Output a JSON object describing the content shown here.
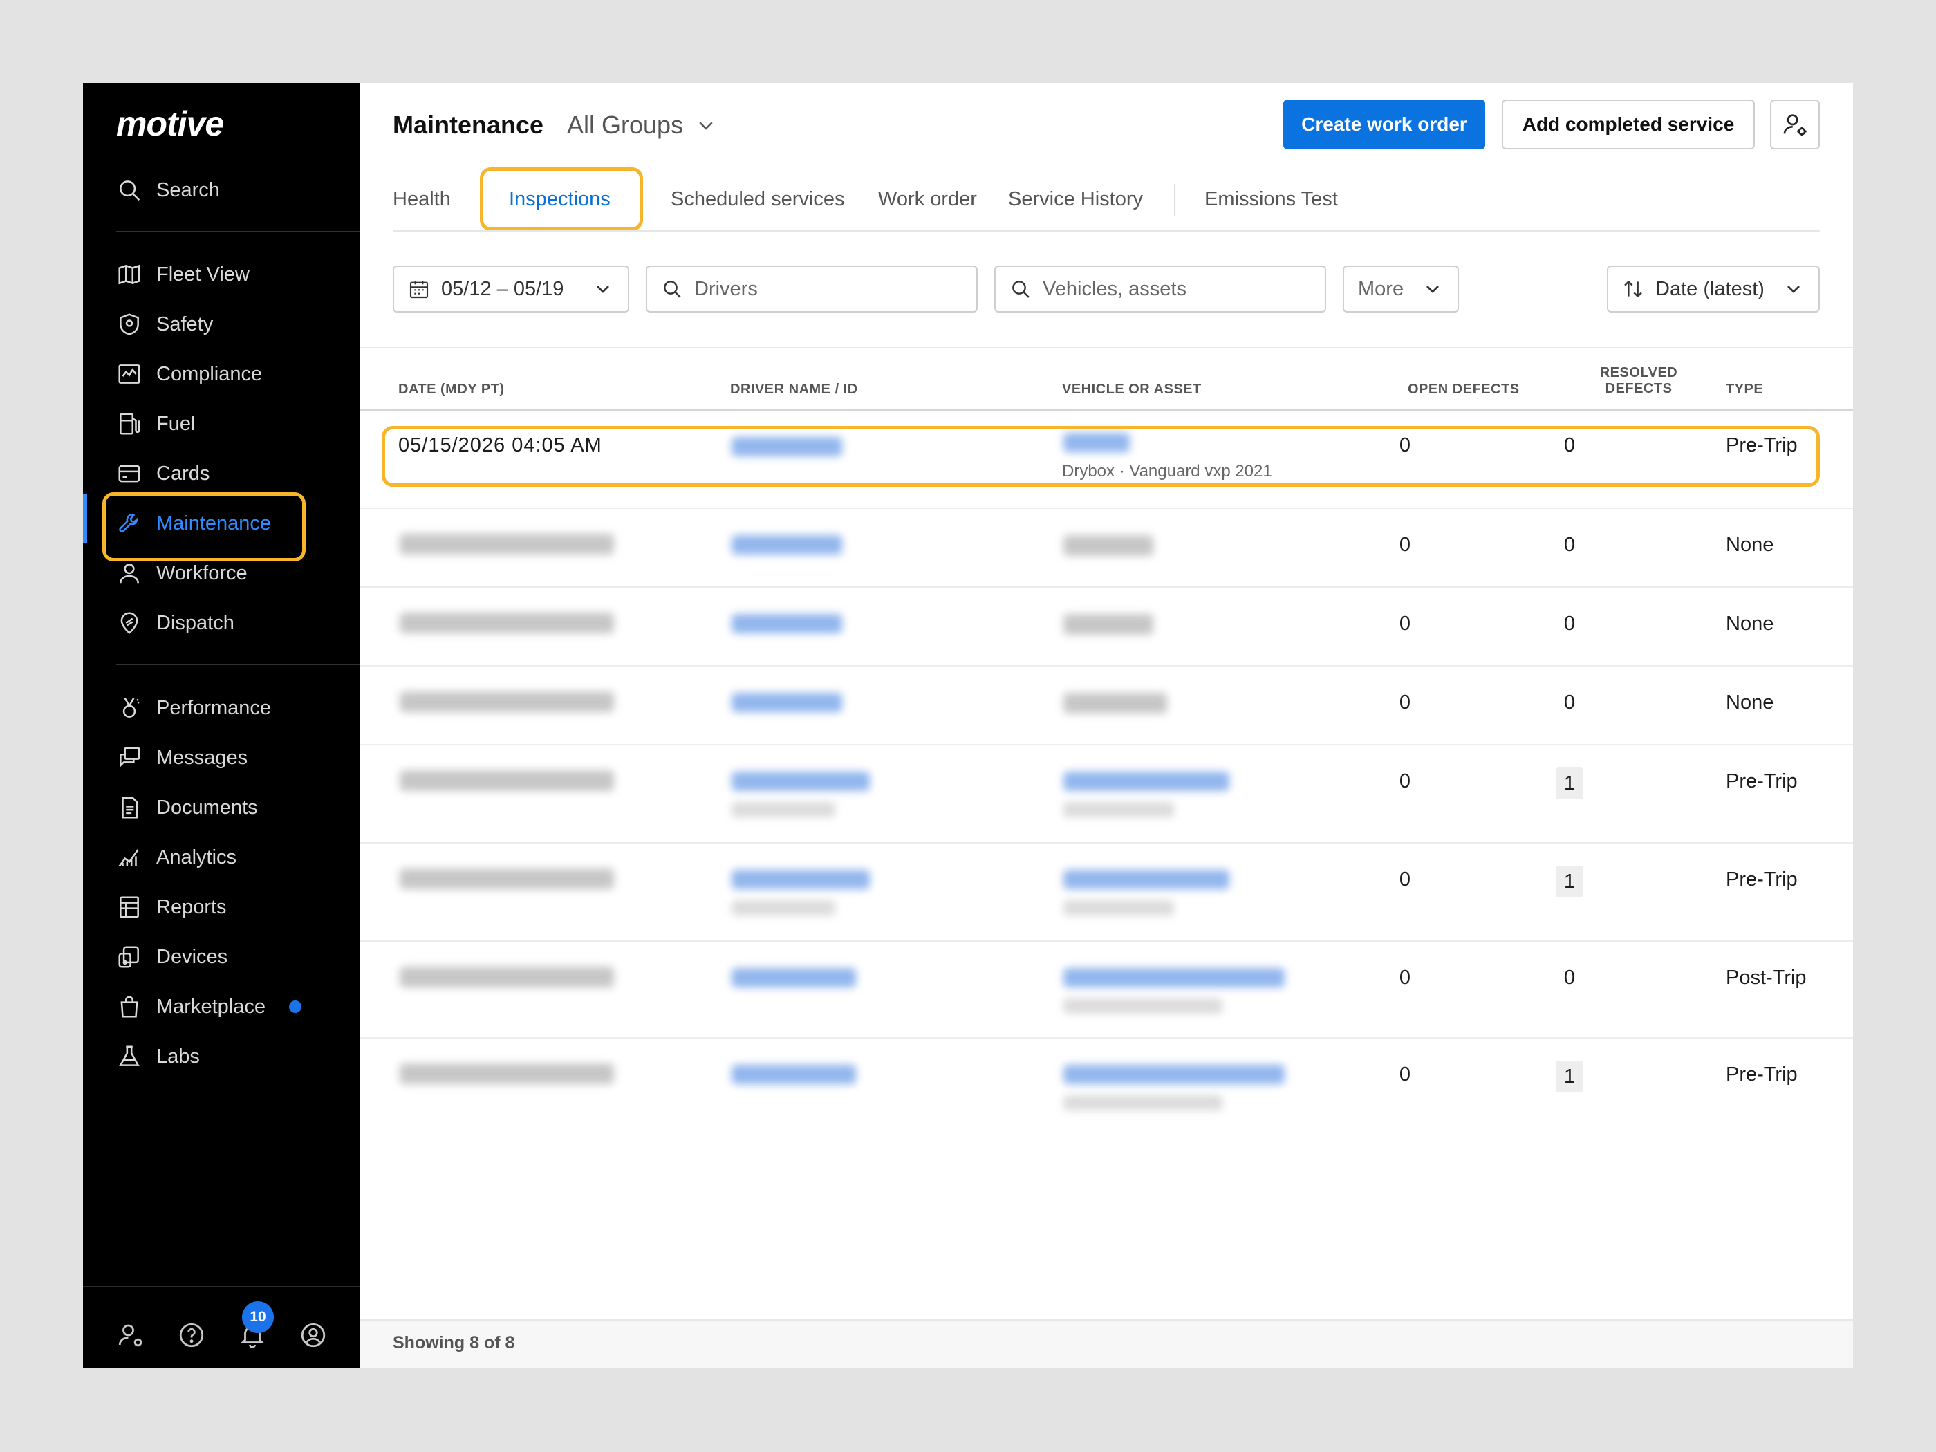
{
  "app": {
    "logo": "motive",
    "accent_color": "#0a73e0",
    "highlight_color": "#f7b52c"
  },
  "sidebar": {
    "search_label": "Search",
    "items_group1": [
      {
        "label": "Fleet View",
        "icon": "map-icon"
      },
      {
        "label": "Safety",
        "icon": "shield-icon"
      },
      {
        "label": "Compliance",
        "icon": "compliance-icon"
      },
      {
        "label": "Fuel",
        "icon": "fuel-icon"
      },
      {
        "label": "Cards",
        "icon": "card-icon"
      },
      {
        "label": "Maintenance",
        "icon": "wrench-icon",
        "active": true
      },
      {
        "label": "Workforce",
        "icon": "person-icon"
      },
      {
        "label": "Dispatch",
        "icon": "dispatch-icon"
      }
    ],
    "items_group2": [
      {
        "label": "Performance",
        "icon": "medal-icon"
      },
      {
        "label": "Messages",
        "icon": "messages-icon"
      },
      {
        "label": "Documents",
        "icon": "document-icon"
      },
      {
        "label": "Analytics",
        "icon": "analytics-icon"
      },
      {
        "label": "Reports",
        "icon": "reports-icon"
      },
      {
        "label": "Devices",
        "icon": "devices-icon"
      },
      {
        "label": "Marketplace",
        "icon": "bag-icon",
        "dot": true
      },
      {
        "label": "Labs",
        "icon": "flask-icon"
      }
    ],
    "footer": {
      "notification_count": "10"
    }
  },
  "header": {
    "title": "Maintenance",
    "group_select": "All Groups",
    "create_button": "Create work order",
    "add_button": "Add completed service"
  },
  "tabs": [
    "Health",
    "Inspections",
    "Scheduled services",
    "Work order",
    "Service History",
    "Emissions Test"
  ],
  "active_tab": "Inspections",
  "filters": {
    "date_range": "05/12 – 05/19",
    "drivers_placeholder": "Drivers",
    "vehicles_placeholder": "Vehicles, assets",
    "more_label": "More",
    "sort_label": "Date (latest)"
  },
  "table": {
    "headers": {
      "date": "DATE (MDY PT)",
      "driver": "DRIVER NAME / ID",
      "vehicle": "VEHICLE OR ASSET",
      "open_defects": "OPEN DEFECTS",
      "resolved_defects_1": "RESOLVED",
      "resolved_defects_2": "DEFECTS",
      "type": "TYPE"
    },
    "first_row": {
      "date": "05/15/2026 04:05 AM",
      "vehicle_sub": "Drybox · Vanguard vxp 2021",
      "open_defects": "0",
      "resolved_defects": "0",
      "type": "Pre-Trip"
    },
    "rows": [
      {
        "open_defects": "0",
        "resolved_defects": "0",
        "type": "None"
      },
      {
        "open_defects": "0",
        "resolved_defects": "0",
        "type": "None"
      },
      {
        "open_defects": "0",
        "resolved_defects": "0",
        "type": "None"
      },
      {
        "open_defects": "0",
        "resolved_defects": "1",
        "type": "Pre-Trip"
      },
      {
        "open_defects": "0",
        "resolved_defects": "1",
        "type": "Pre-Trip"
      },
      {
        "open_defects": "0",
        "resolved_defects": "0",
        "type": "Post-Trip"
      },
      {
        "open_defects": "0",
        "resolved_defects": "1",
        "type": "Pre-Trip"
      }
    ]
  },
  "footer": {
    "showing": "Showing 8 of 8"
  }
}
